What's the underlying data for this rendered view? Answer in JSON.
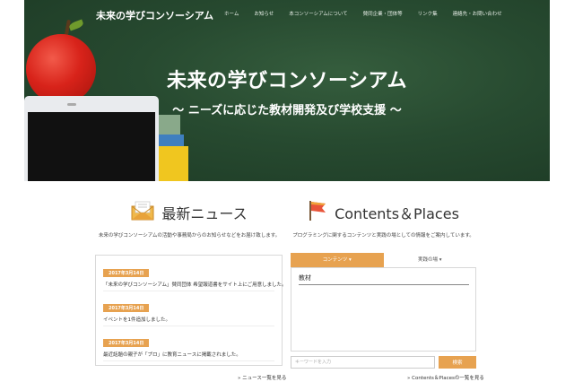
{
  "header": {
    "site_title": "未来の学びコンソーシアム",
    "nav": [
      "ホーム",
      "お知らせ",
      "本コンソーシアムについて",
      "賛同企業・団体等",
      "リンク集",
      "連絡先・お問い合わせ"
    ]
  },
  "hero": {
    "title": "未来の学びコンソーシアム",
    "subtitle": "～ ニーズに応じた教材開発及び学校支援 ～"
  },
  "news": {
    "heading": "最新ニュース",
    "description": "未来の学びコンソーシアムの活動や事務局からのお知らせなどをお届け致します。",
    "items": [
      {
        "date": "2017年3月14日",
        "text": "「未来の学びコンソーシアム」賛同団体 希望報道書をサイト上にご用意しました。"
      },
      {
        "date": "2017年3月14日",
        "text": "イベントを1件追加しました。"
      },
      {
        "date": "2017年3月14日",
        "text": "最近話題の親子が「プロ」に教育ニュースに掲載されました。"
      }
    ],
    "more_link": "» ニュース一覧を見る"
  },
  "contents": {
    "heading": "Contents＆Places",
    "description": "プログラミングに関するコンテンツと実践の場としての情報をご案内しています。",
    "tabs": [
      "コンテンツ ▾",
      "実践の場 ▾"
    ],
    "panel_label": "教材",
    "search_placeholder": "キーワードを入力",
    "search_button": "検索",
    "more_link": "» Contents＆Placesの一覧を見る"
  },
  "colors": {
    "accent": "#e7a250",
    "hero_green": "#274a30"
  }
}
